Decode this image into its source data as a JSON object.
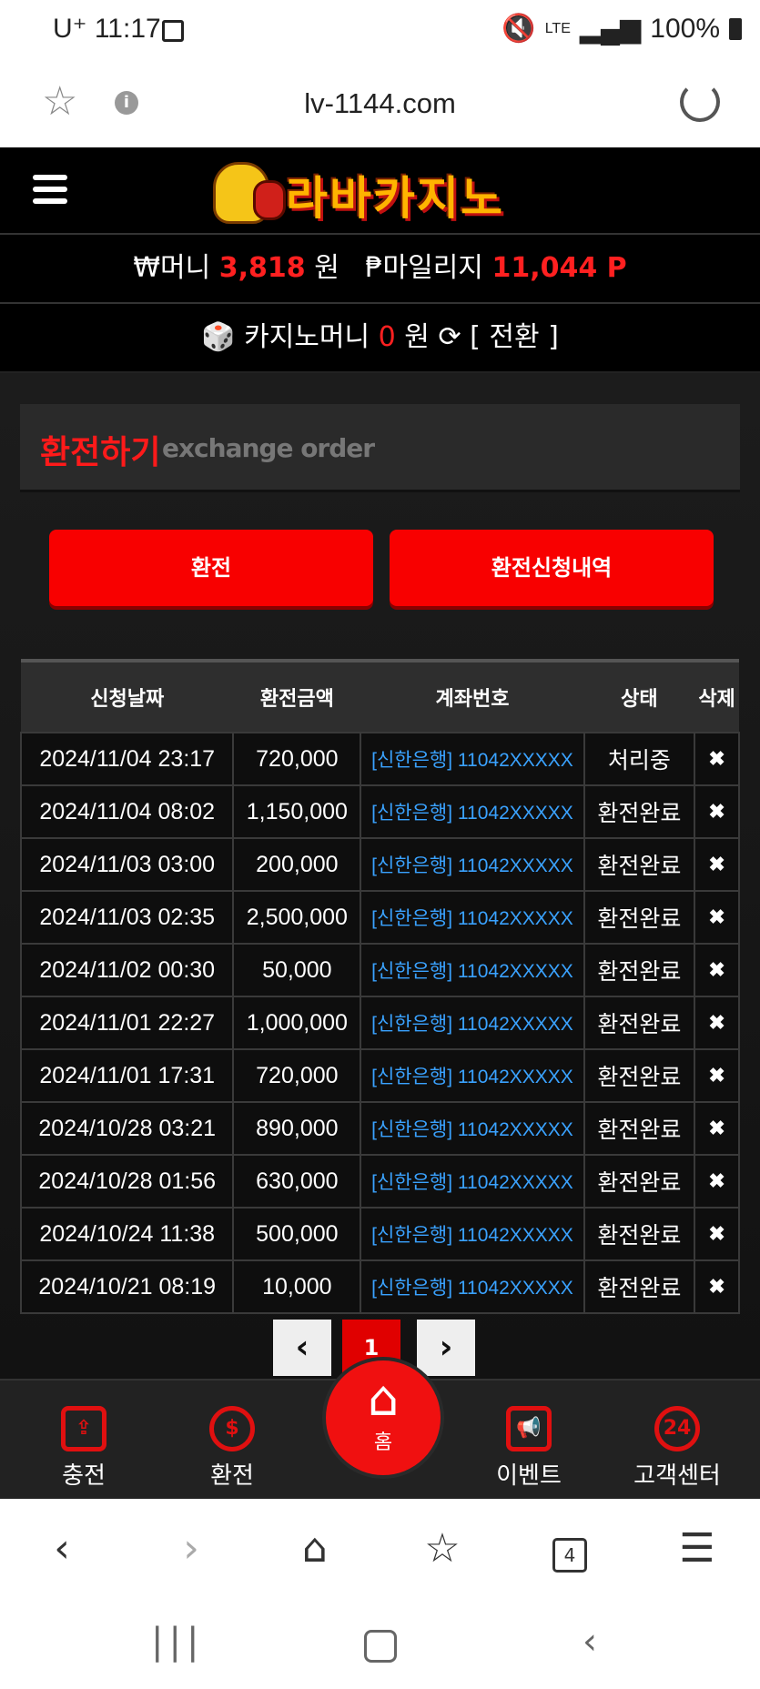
{
  "status_bar": {
    "time": "U⁺ 11:17",
    "battery": "100%",
    "network": "LTE"
  },
  "browser": {
    "url": "lv-1144.com",
    "icons": [
      "star-icon",
      "info-icon",
      "reload-icon"
    ]
  },
  "site": {
    "logo_text": "라바카지노",
    "money_label": "₩머니",
    "money_value": "3,818",
    "money_unit": "원",
    "mileage_label": "₱마일리지",
    "mileage_value": "11,044 P",
    "casino_label": "카지노머니",
    "casino_value": "0",
    "casino_unit": "원",
    "convert_label": "[ 전환 ]"
  },
  "page": {
    "title_ko": "환전하기",
    "title_en": "exchange order",
    "btn_exchange": "환전",
    "btn_history": "환전신청내역"
  },
  "table": {
    "headers": [
      "신청날짜",
      "환전금액",
      "계좌번호",
      "상태",
      "삭제"
    ],
    "rows": [
      {
        "date": "2024/11/04 23:17",
        "amount": "720,000",
        "account": "[신한은행] 11042XXXXX",
        "status": "처리중",
        "del": "✖"
      },
      {
        "date": "2024/11/04 08:02",
        "amount": "1,150,000",
        "account": "[신한은행] 11042XXXXX",
        "status": "환전완료",
        "del": "✖"
      },
      {
        "date": "2024/11/03 03:00",
        "amount": "200,000",
        "account": "[신한은행] 11042XXXXX",
        "status": "환전완료",
        "del": "✖"
      },
      {
        "date": "2024/11/03 02:35",
        "amount": "2,500,000",
        "account": "[신한은행] 11042XXXXX",
        "status": "환전완료",
        "del": "✖"
      },
      {
        "date": "2024/11/02 00:30",
        "amount": "50,000",
        "account": "[신한은행] 11042XXXXX",
        "status": "환전완료",
        "del": "✖"
      },
      {
        "date": "2024/11/01 22:27",
        "amount": "1,000,000",
        "account": "[신한은행] 11042XXXXX",
        "status": "환전완료",
        "del": "✖"
      },
      {
        "date": "2024/11/01 17:31",
        "amount": "720,000",
        "account": "[신한은행] 11042XXXXX",
        "status": "환전완료",
        "del": "✖"
      },
      {
        "date": "2024/10/28 03:21",
        "amount": "890,000",
        "account": "[신한은행] 11042XXXXX",
        "status": "환전완료",
        "del": "✖"
      },
      {
        "date": "2024/10/28 01:56",
        "amount": "630,000",
        "account": "[신한은행] 11042XXXXX",
        "status": "환전완료",
        "del": "✖"
      },
      {
        "date": "2024/10/24 11:38",
        "amount": "500,000",
        "account": "[신한은행] 11042XXXXX",
        "status": "환전완료",
        "del": "✖"
      },
      {
        "date": "2024/10/21 08:19",
        "amount": "10,000",
        "account": "[신한은행] 11042XXXXX",
        "status": "환전완료",
        "del": "✖"
      }
    ]
  },
  "pagination": {
    "prev": "‹",
    "current": "1",
    "next": "›"
  },
  "bottom_nav": {
    "charge": "충전",
    "exchange": "환전",
    "home": "홈",
    "event": "이벤트",
    "cs": "고객센터",
    "cs_badge": "24"
  },
  "browser_toolbar": {
    "tab_count": "4"
  },
  "colors": {
    "accent_red": "#f80000",
    "account_blue": "#3aa2ff",
    "header_bg": "#000000"
  }
}
